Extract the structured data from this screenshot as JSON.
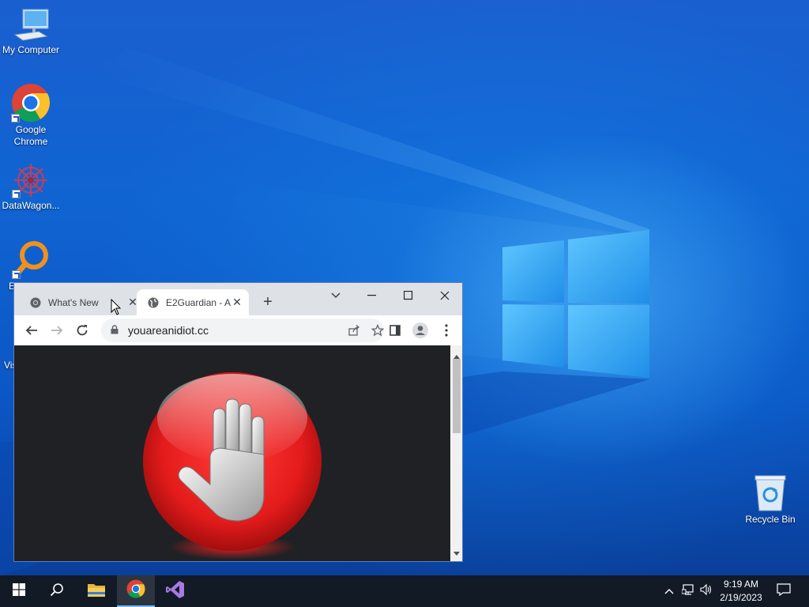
{
  "desktop": {
    "icons": [
      {
        "label": "My Computer"
      },
      {
        "label": "Google Chrome"
      },
      {
        "label": "DataWagon..."
      },
      {
        "label": "E"
      },
      {
        "label": "Vis"
      },
      {
        "label": "Recycle Bin"
      }
    ]
  },
  "browser": {
    "tabs": [
      {
        "title": "What's New",
        "icon": "chrome-icon",
        "active": false
      },
      {
        "title": "E2Guardian - A",
        "icon": "globe-icon",
        "active": true
      }
    ],
    "new_tab_glyph": "+",
    "address": "youareanidiot.cc",
    "content": {
      "background": "#202124",
      "image": "red-stop-hand-icon",
      "accent": "#e41b1b"
    }
  },
  "taskbar": {
    "pinned": [
      "windows-start-icon",
      "search-icon",
      "file-explorer-icon",
      "chrome-icon",
      "visual-studio-icon"
    ],
    "tray": [
      "chevron-up-icon",
      "network-icon",
      "volume-icon"
    ],
    "time": "9:19 AM",
    "date": "2/19/2023",
    "notification_icon": "action-center-icon"
  }
}
